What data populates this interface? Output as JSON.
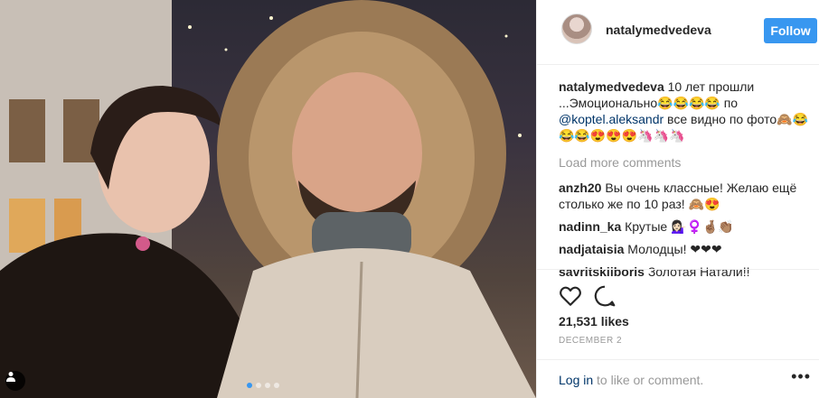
{
  "post": {
    "username": "natalymedvedeva",
    "follow_label": "Follow",
    "caption_user": "natalymedvedeva",
    "caption_text_1": " 10 лет прошли ...Эмоционально😂😂😂😂 по ",
    "caption_mention": "@koptel.aleksandr",
    "caption_text_2": " все видно по фото🙈😂😂😂😍😍😍🦄🦄🦄",
    "load_more": "Load more comments",
    "comments": [
      {
        "user": "anzh20",
        "text": " Вы очень классные! Желаю ещё столько же по 10 раз! 🙈😍"
      },
      {
        "user": "nadinn_ka",
        "text": " Крутые 💁🏻‍♀️♀️🤞🏽👏🏽"
      },
      {
        "user": "nadjataisia",
        "text": " Молодцы! ❤❤❤"
      },
      {
        "user": "savritskiiboris",
        "text": " Золотая Натали!!"
      }
    ],
    "likes": "21,531 likes",
    "date": "DECEMBER 2",
    "login_link": "Log in",
    "login_text": " to like or comment.",
    "more_label": "•••"
  },
  "icons": {
    "like": "heart-outline-icon",
    "comment": "comment-bubble-icon",
    "user_tag": "person-icon"
  },
  "colors": {
    "accent": "#3897f0",
    "link": "#003569",
    "muted": "#999999"
  },
  "carousel": {
    "count": 4,
    "active_index": 0
  }
}
